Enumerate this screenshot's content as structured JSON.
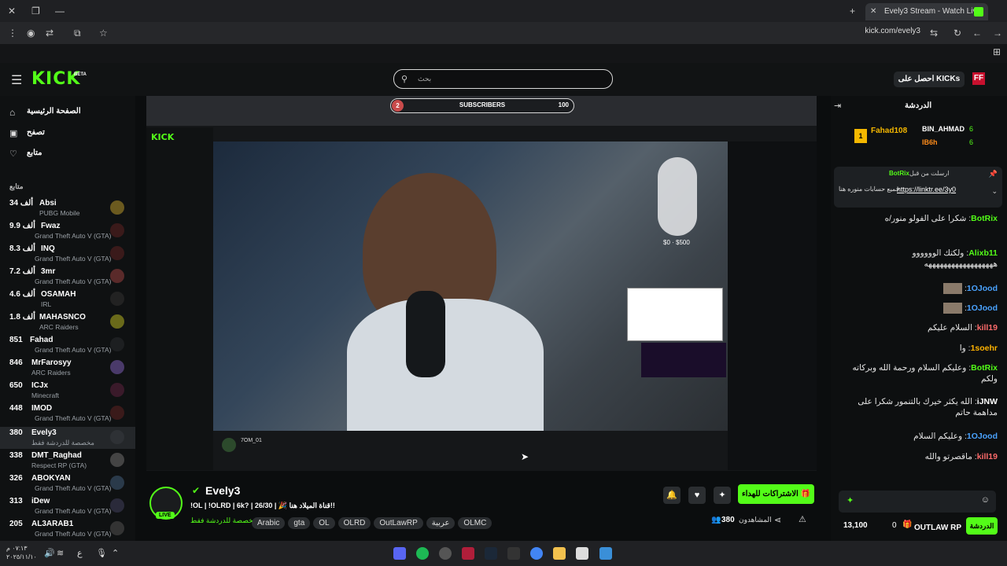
{
  "browser": {
    "tab_title": "Evely3 Stream - Watch Live",
    "url": "kick.com/evely3",
    "new_tab": "+",
    "close_tab": "✕"
  },
  "header": {
    "logo": "KICK",
    "logo_badge": "BETA",
    "search_placeholder": "بحث",
    "get_kicks": "احصل على KICKs"
  },
  "sidebar": {
    "nav": [
      "الصفحة الرئيسية",
      "تصفح",
      "متابع"
    ],
    "following_title": "متابع",
    "following": [
      {
        "count": "34 ألف",
        "name": "Absi",
        "category": "PUBG Mobile"
      },
      {
        "count": "9.9 ألف",
        "name": "Fwaz",
        "category": "Grand Theft Auto V (GTA)"
      },
      {
        "count": "8.3 ألف",
        "name": "INQ",
        "category": "Grand Theft Auto V (GTA)"
      },
      {
        "count": "7.2 ألف",
        "name": "3mr",
        "category": "Grand Theft Auto V (GTA)"
      },
      {
        "count": "4.6 ألف",
        "name": "OSAMAH",
        "category": "IRL"
      },
      {
        "count": "1.8 ألف",
        "name": "MAHASNCO",
        "category": "ARC Raiders"
      },
      {
        "count": "851",
        "name": "Fahad",
        "category": "Grand Theft Auto V (GTA)"
      },
      {
        "count": "846",
        "name": "MrFarosyy",
        "category": "ARC Raiders"
      },
      {
        "count": "650",
        "name": "ICJx",
        "category": "Minecraft"
      },
      {
        "count": "448",
        "name": "IMOD",
        "category": "Grand Theft Auto V (GTA)"
      },
      {
        "count": "380",
        "name": "Evely3",
        "category": "مخصصة للدردشة فقط"
      },
      {
        "count": "338",
        "name": "DMT_Raghad",
        "category": "Respect RP (GTA)"
      },
      {
        "count": "326",
        "name": "ABOKYAN",
        "category": "Grand Theft Auto V (GTA)"
      },
      {
        "count": "313",
        "name": "iDew",
        "category": "Grand Theft Auto V (GTA)"
      },
      {
        "count": "205",
        "name": "AL3ARAB1",
        "category": "Grand Theft Auto V (GTA)"
      }
    ]
  },
  "overlay": {
    "sub_current": "2",
    "sub_label": "SUBSCRIBERS",
    "sub_goal": "100",
    "goal_text": "$0 · $500",
    "inner_streamer": "7OM_01"
  },
  "stream_info": {
    "streamer": "Evely3",
    "title": "!OL | !OLRD | 6k? | 26/30 | 🎉 قناة الميلاد هنا!!",
    "category": "مخصصة للدردشة فقط",
    "tags": [
      "Arabic",
      "gta",
      "OL",
      "OLRD",
      "OutLawRP",
      "عربية",
      "OLMC"
    ],
    "viewers_label": "المشاهدون",
    "viewers": "380",
    "live_badge": "LIVE",
    "gift_button": "الاشتراكات للهداء"
  },
  "chat": {
    "title": "الدردشة",
    "leaderboard": [
      {
        "name": "Fahad108",
        "count": "1"
      },
      {
        "name": "BIN_AHMAD",
        "count": "6"
      },
      {
        "name": "IB6h",
        "count": "6"
      }
    ],
    "pinned_by": "ارسلت من قبل",
    "pinned_user": "BotRix",
    "pinned_text": "جميع حسابات منوره هنا",
    "pinned_link": "https://linktr.ee/3y0",
    "messages": [
      {
        "user": "BotRix",
        "color": "#53fc18",
        "text": "شكرا على الفولو منور/ه"
      },
      {
        "user": "Alixb11",
        "color": "#53fc18",
        "text": "ولكتك الوووووو ههههههههههههههههههه"
      },
      {
        "user": "1OJood",
        "color": "#4aa3ff",
        "text": ""
      },
      {
        "user": "1OJood",
        "color": "#4aa3ff",
        "text": ""
      },
      {
        "user": "kill19",
        "color": "#ff6b6b",
        "text": "السلام عليكم"
      },
      {
        "user": "1soehr",
        "color": "#ffb300",
        "text": "وا"
      },
      {
        "user": "BotRix",
        "color": "#53fc18",
        "text": "وعليكم السلام ورحمة الله وبركاته ولكم"
      },
      {
        "user": "iJNW",
        "color": "#ffffff",
        "text": "الله يكثر خيرك بالتنمور شكرا على مداهمة حاتم"
      },
      {
        "user": "1OJood",
        "color": "#4aa3ff",
        "text": "وعليكم السلام"
      },
      {
        "user": "kill19",
        "color": "#ff6b6b",
        "text": "ماقصرتو والله"
      }
    ],
    "points": "13,100",
    "zero": "0",
    "send": "الدردشة",
    "watermark": "OUTLAW RP"
  },
  "taskbar": {
    "time": "٠٧:١٣ م",
    "date": "٢٠٢٥/١١/١٠",
    "lang": "ع"
  }
}
